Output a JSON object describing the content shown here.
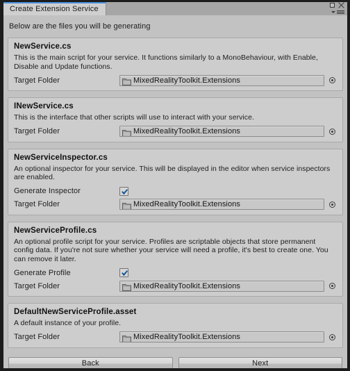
{
  "window": {
    "tab_title": "Create Extension Service",
    "controls": {
      "maximize": "maximize-icon",
      "close": "close-icon",
      "menu": "panel-menu-icon"
    },
    "accent_color": "#4a90d9"
  },
  "intro_text": "Below are the files you will be generating",
  "common": {
    "target_folder_label": "Target Folder",
    "target_folder_value": "MixedRealityToolkit.Extensions",
    "folder_icon": "folder-icon",
    "picker_icon": "object-picker-icon",
    "checkbox_checked": true
  },
  "sections": [
    {
      "title": "NewService.cs",
      "description": "This is the main script for your service. It functions similarly to a MonoBehaviour, with Enable, Disable and Update functions.",
      "toggle_label": null,
      "toggle_checked": null,
      "folder_label": "Target Folder",
      "folder_value": "MixedRealityToolkit.Extensions"
    },
    {
      "title": "INewService.cs",
      "description": "This is the interface that other scripts will use to interact with your service.",
      "toggle_label": null,
      "toggle_checked": null,
      "folder_label": "Target Folder",
      "folder_value": "MixedRealityToolkit.Extensions"
    },
    {
      "title": "NewServiceInspector.cs",
      "description": "An optional inspector for your service. This will be displayed in the editor when service inspectors are enabled.",
      "toggle_label": "Generate Inspector",
      "toggle_checked": true,
      "folder_label": "Target Folder",
      "folder_value": "MixedRealityToolkit.Extensions"
    },
    {
      "title": "NewServiceProfile.cs",
      "description": "An optional profile script for your service. Profiles are scriptable objects that store permanent config data. If you're not sure whether your service will need a profile, it's best to create one. You can remove it later.",
      "toggle_label": "Generate Profile",
      "toggle_checked": true,
      "folder_label": "Target Folder",
      "folder_value": "MixedRealityToolkit.Extensions"
    },
    {
      "title": "DefaultNewServiceProfile.asset",
      "description": "A default instance of your profile.",
      "toggle_label": null,
      "toggle_checked": null,
      "folder_label": "Target Folder",
      "folder_value": "MixedRealityToolkit.Extensions"
    }
  ],
  "footer": {
    "back_label": "Back",
    "next_label": "Next"
  }
}
